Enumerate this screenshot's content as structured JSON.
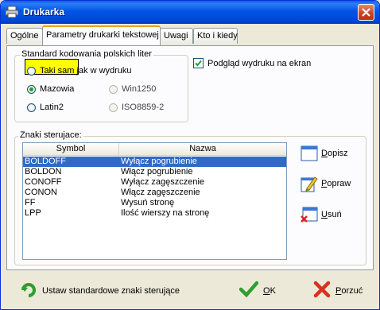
{
  "window": {
    "title": "Drukarka"
  },
  "tabs": [
    {
      "label": "Ogólne"
    },
    {
      "label": "Parametry drukarki tekstowej"
    },
    {
      "label": "Uwagi"
    },
    {
      "label": "Kto i kiedy"
    }
  ],
  "encoding": {
    "legend": "Standard kodowania polskich liter",
    "options": [
      {
        "label": "Taki sam jak w wydruku",
        "checked": false
      },
      {
        "label": "Mazowia",
        "checked": true
      },
      {
        "label": "Win1250",
        "checked": false
      },
      {
        "label": "Latin2",
        "checked": false
      },
      {
        "label": "ISO8859-2",
        "checked": false
      }
    ]
  },
  "preview_checkbox": {
    "label": "Podgląd wydruku na ekran",
    "checked": true
  },
  "control_chars": {
    "legend": "Znaki sterujace:",
    "columns": [
      "Symbol",
      "Nazwa"
    ],
    "rows": [
      {
        "symbol": "BOLDOFF",
        "name": "Wyłącz pogrubienie"
      },
      {
        "symbol": "BOLDON",
        "name": "Włącz pogrubienie"
      },
      {
        "symbol": "CONOFF",
        "name": "Wyłącz zagęszczenie"
      },
      {
        "symbol": "CONON",
        "name": "Włącz zagęszczenie"
      },
      {
        "symbol": "FF",
        "name": "Wysuń stronę"
      },
      {
        "symbol": "LPP",
        "name": "Ilość wierszy na stronę"
      }
    ],
    "selected_row": 0
  },
  "side_buttons": {
    "add": {
      "key": "D",
      "rest": "opisz"
    },
    "edit": {
      "key": "P",
      "rest": "opraw"
    },
    "delete": {
      "key": "U",
      "rest": "suń"
    }
  },
  "bottom": {
    "defaults_label": "Ustaw standardowe znaki sterujące",
    "ok": {
      "key": "O",
      "rest": "K"
    },
    "cancel": {
      "key": "P",
      "rest": "orzuć"
    }
  },
  "colors": {
    "titlebar": "#0055e5",
    "selection": "#3169c6",
    "highlight": "#ffff00",
    "radio_dot": "#21a121"
  }
}
